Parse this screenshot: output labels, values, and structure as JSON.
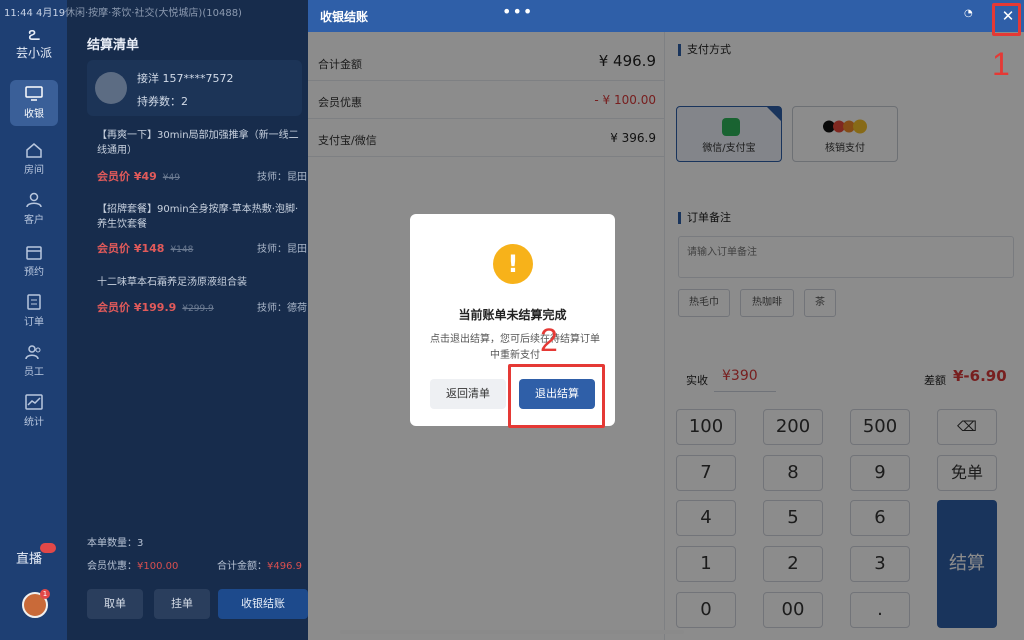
{
  "status_bar": {
    "text": "11:44 4月19日周六",
    "org": "休闲·按摩·茶饮·社交(大悦城店)(10488)"
  },
  "sidebar": {
    "logo": "芸小派",
    "items": [
      {
        "label": "收银",
        "icon": "cash-register-icon"
      },
      {
        "label": "房间",
        "icon": "home-icon"
      },
      {
        "label": "客户",
        "icon": "user-icon"
      },
      {
        "label": "预约",
        "icon": "calendar-icon"
      },
      {
        "label": "订单",
        "icon": "document-icon"
      },
      {
        "label": "员工",
        "icon": "staff-icon"
      },
      {
        "label": "统计",
        "icon": "chart-icon"
      }
    ],
    "bottom_label": "直播"
  },
  "cart": {
    "title": "结算清单",
    "member": {
      "name": "接洋 157****7572",
      "coupon": "持券数：2"
    },
    "items": [
      {
        "name": "【再爽一下】30min局部加强推拿（新一线二线通用）",
        "price": "会员价 ¥49",
        "orig": "¥49",
        "tech": "技师：昆田"
      },
      {
        "name": "【招牌套餐】90min全身按摩·草本热敷·泡脚·养生饮套餐",
        "price": "会员价 ¥148",
        "orig": "¥148",
        "tech": "技师：昆田"
      },
      {
        "name": "十二味草本石霜养足汤原液组合装",
        "price": "会员价 ¥199.9",
        "orig": "¥299.9",
        "tech": "技师：德荷"
      }
    ],
    "count_label": "本单数量：3",
    "member_discount_label": "会员优惠：",
    "member_discount_value": "¥100.00",
    "total_label": "合计金额：",
    "total_value": "¥496.9",
    "btn_take": "取单",
    "btn_hold": "挂单",
    "btn_checkout": "收银结账"
  },
  "checkout": {
    "title": "收银结账",
    "dots": "•••",
    "summary": [
      {
        "label": "合计金额",
        "value": "¥ 496.9"
      },
      {
        "label": "会员优惠",
        "value": "- ¥ 100.00"
      },
      {
        "label": "支付宝/微信",
        "value": "¥ 396.9"
      }
    ],
    "payment_title": "支付方式",
    "payment_methods": [
      {
        "label": "微信/支付宝"
      },
      {
        "label": "核销支付"
      }
    ],
    "note_title": "订单备注",
    "note_placeholder": "请输入订单备注",
    "tags": [
      "热毛巾",
      "热咖啡",
      "茶"
    ],
    "paid_label": "实收",
    "paid_value": "¥390",
    "diff_label": "差额",
    "diff_value": "¥-6.90",
    "keys": [
      [
        "100",
        "200",
        "500",
        "⌫"
      ],
      [
        "7",
        "8",
        "9",
        "免单"
      ],
      [
        "4",
        "5",
        "6"
      ],
      [
        "1",
        "2",
        "3"
      ],
      [
        "0",
        "00",
        "."
      ]
    ],
    "settle": "结算"
  },
  "modal": {
    "icon": "!",
    "title": "当前账单未结算完成",
    "body": "点击退出结算，您可后续在待结算订单中重新支付",
    "btn_back": "返回清单",
    "btn_exit": "退出结算"
  },
  "annotations": {
    "one": "1",
    "two": "2"
  }
}
